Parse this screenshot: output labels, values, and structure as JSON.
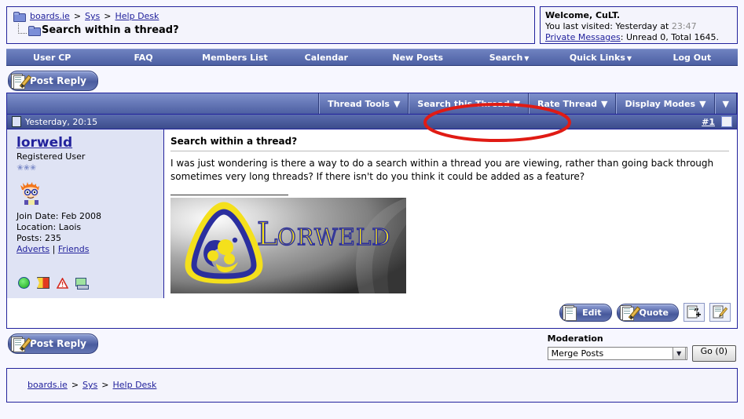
{
  "header": {
    "breadcrumb": [
      {
        "label": "boards.ie",
        "link": true
      },
      {
        "label": "Sys",
        "link": true
      },
      {
        "label": "Help Desk",
        "link": true
      }
    ],
    "separator": ">",
    "thread_title": "Search within a thread?",
    "folder_icon": "folder-icon",
    "thread_icon": "thread-folder-icon"
  },
  "welcome": {
    "greeting": "Welcome, CuLT.",
    "last_visited_label": "You last visited: Yesterday at",
    "last_visited_time": "23:47",
    "pm_link": "Private Messages",
    "pm_status": ": Unread 0, Total 1645."
  },
  "nav": {
    "items": [
      {
        "label": "User CP",
        "caret": false
      },
      {
        "label": "FAQ",
        "caret": false
      },
      {
        "label": "Members List",
        "caret": false
      },
      {
        "label": "Calendar",
        "caret": false
      },
      {
        "label": "New Posts",
        "caret": false
      },
      {
        "label": "Search",
        "caret": true
      },
      {
        "label": "Quick Links",
        "caret": true
      },
      {
        "label": "Log Out",
        "caret": false
      }
    ],
    "caret_glyph": "▼"
  },
  "post_reply_top": {
    "label": "Post Reply",
    "icon": "post-reply-icon"
  },
  "post_reply_bottom": {
    "label": "Post Reply",
    "icon": "post-reply-icon"
  },
  "toolbar": {
    "buttons": [
      {
        "label": "Thread Tools",
        "caret": "▼"
      },
      {
        "label": "Search this Thread",
        "caret": "▼"
      },
      {
        "label": "Rate Thread",
        "caret": "▼"
      },
      {
        "label": "Display Modes",
        "caret": "▼"
      }
    ],
    "overflow_caret": "▼"
  },
  "post": {
    "timestamp": "Yesterday, 20:15",
    "post_number": "#1",
    "page_icon": "page-icon",
    "select_checkbox": "post-select-checkbox",
    "user": {
      "name": "lorweld",
      "title": "Registered User",
      "stars": "✬✬✬",
      "avatar_alt": "user-avatar",
      "join_date": "Join Date: Feb 2008",
      "location": "Location: Laois",
      "posts": "Posts: 235",
      "adverts_link": "Adverts",
      "link_sep": "|",
      "friends_link": "Friends",
      "status_icons": [
        "online-status-icon",
        "report-flag-icon",
        "warning-triangle-icon",
        "ip-computer-icon"
      ]
    },
    "title": "Search within a thread?",
    "body": "I was just wondering is there a way to do a search within a thread you are viewing, rather than going back through sometimes very long threads? If there isn't do you think it could be added as a feature?",
    "signature": {
      "logo_text": "LORWELD",
      "alt": "lorweld-signature-image"
    },
    "actions": [
      {
        "label": "Edit",
        "icon": "edit-scissors-icon",
        "type": "pill"
      },
      {
        "label": "Quote",
        "icon": "quote-pencil-icon",
        "type": "pill"
      },
      {
        "label": "",
        "icon": "multi-quote-icon",
        "type": "icon"
      },
      {
        "label": "",
        "icon": "quick-reply-icon",
        "type": "icon"
      }
    ]
  },
  "moderation": {
    "label": "Moderation",
    "selected_option": "Merge Posts",
    "dropdown_caret": "▼",
    "go_button": "Go (0)"
  },
  "footer": {
    "breadcrumb": [
      {
        "label": "boards.ie"
      },
      {
        "label": "Sys"
      },
      {
        "label": "Help Desk"
      }
    ],
    "separator": ">"
  },
  "annotation": {
    "type": "red-ellipse-highlight",
    "target": "Search this Thread",
    "color": "#e01b14"
  },
  "colors": {
    "link": "#22229c",
    "nav_bar": "#4c5fa3",
    "panel_bg": "#dfe3f4",
    "page_bg": "#f7f7ff",
    "annotation_red": "#e01b14"
  }
}
